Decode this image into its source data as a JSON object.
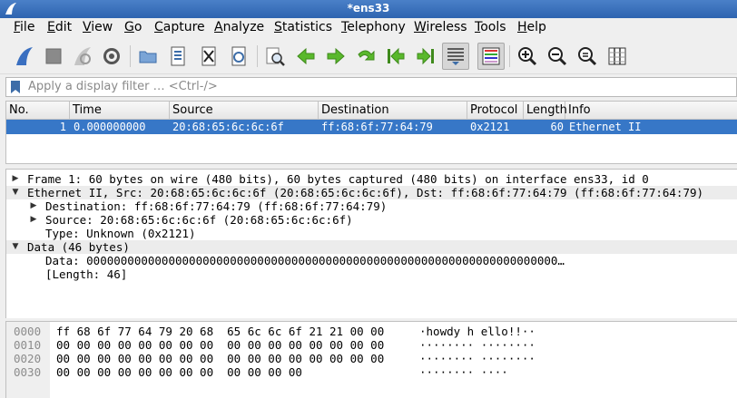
{
  "window": {
    "title": "*ens33"
  },
  "menu": [
    "File",
    "Edit",
    "View",
    "Go",
    "Capture",
    "Analyze",
    "Statistics",
    "Telephony",
    "Wireless",
    "Tools",
    "Help"
  ],
  "toolbar": {
    "buttons": [
      "start-capture",
      "stop-capture",
      "restart-capture",
      "capture-options",
      "open-file",
      "save-file",
      "close-file",
      "reload-file",
      "find-packet",
      "go-back",
      "go-forward",
      "go-to-packet",
      "go-first-packet",
      "go-last-packet",
      "auto-scroll",
      "colorize",
      "zoom-in",
      "zoom-out",
      "normal-size",
      "resize-columns"
    ]
  },
  "filter": {
    "placeholder": "Apply a display filter … <Ctrl-/>",
    "value": ""
  },
  "packet_list": {
    "columns": [
      "No.",
      "Time",
      "Source",
      "Destination",
      "Protocol",
      "Length",
      "Info"
    ],
    "rows": [
      {
        "no": "1",
        "time": "0.000000000",
        "source": "20:68:65:6c:6c:6f",
        "destination": "ff:68:6f:77:64:79",
        "protocol": "0x2121",
        "length": "60",
        "info": "Ethernet II"
      }
    ],
    "selected_color": "#3777c7"
  },
  "details": {
    "rows": [
      {
        "text": "Frame 1: 60 bytes on wire (480 bits), 60 bytes captured (480 bits) on interface ens33, id 0",
        "expander": "collapsed"
      },
      {
        "text": "Ethernet II, Src: 20:68:65:6c:6c:6f (20:68:65:6c:6c:6f), Dst: ff:68:6f:77:64:79 (ff:68:6f:77:64:79)",
        "expander": "expanded"
      },
      {
        "text": "Destination: ff:68:6f:77:64:79 (ff:68:6f:77:64:79)",
        "expander": "collapsed"
      },
      {
        "text": "Source: 20:68:65:6c:6c:6f (20:68:65:6c:6c:6f)",
        "expander": "collapsed"
      },
      {
        "text": "Type: Unknown (0x2121)",
        "expander": "none"
      },
      {
        "text": "Data (46 bytes)",
        "expander": "expanded"
      },
      {
        "text": "Data: 000000000000000000000000000000000000000000000000000000000000000000000…",
        "expander": "none"
      },
      {
        "text": "[Length: 46]",
        "expander": "none"
      }
    ]
  },
  "bytes": {
    "rows": [
      {
        "offset": "0000",
        "hex": "ff 68 6f 77 64 79 20 68  65 6c 6c 6f 21 21 00 00",
        "ascii": "·howdy h ello!!··"
      },
      {
        "offset": "0010",
        "hex": "00 00 00 00 00 00 00 00  00 00 00 00 00 00 00 00",
        "ascii": "········ ········"
      },
      {
        "offset": "0020",
        "hex": "00 00 00 00 00 00 00 00  00 00 00 00 00 00 00 00",
        "ascii": "········ ········"
      },
      {
        "offset": "0030",
        "hex": "00 00 00 00 00 00 00 00  00 00 00 00",
        "ascii": "········ ····"
      }
    ]
  }
}
